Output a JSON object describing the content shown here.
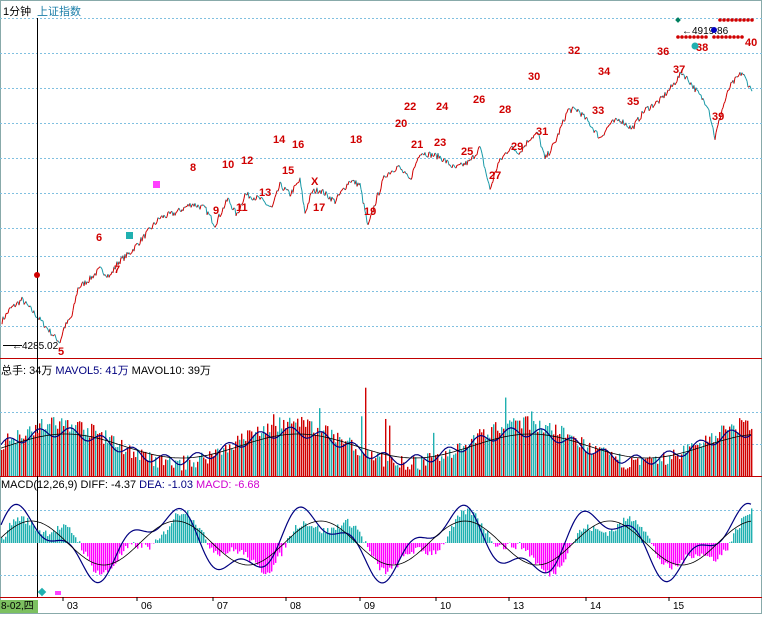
{
  "header": {
    "period": "1分钟",
    "index_name": "上证指数"
  },
  "price_panel": {
    "price_labels": {
      "low": "4285.02",
      "high": "4919.86"
    },
    "wave_labels": [
      "5",
      "6",
      "7",
      "8",
      "9",
      "10",
      "11",
      "12",
      "13",
      "14",
      "15",
      "16",
      "X",
      "17",
      "18",
      "19",
      "20",
      "21",
      "22",
      "23",
      "24",
      "25",
      "26",
      "27",
      "28",
      "29",
      "30",
      "31",
      "32",
      "33",
      "34",
      "35",
      "36",
      "37",
      "38",
      "39",
      "40"
    ]
  },
  "volume_panel": {
    "title": "总手: 34万",
    "mavol5": "MAVOL5: 41万",
    "mavol10": "MAVOL10: 39万"
  },
  "macd_panel": {
    "title": "MACD(12,26,9)",
    "diff": "DIFF: -4.37",
    "dea": "DEA: -1.03",
    "macd": "MACD: -6.68"
  },
  "x_axis": {
    "current_date": "8-02,四",
    "ticks": [
      "03",
      "06",
      "07",
      "08",
      "09",
      "10",
      "13",
      "14",
      "15"
    ]
  },
  "colors": {
    "up": "#d00000",
    "down": "#20b0b0",
    "diff_line": "#000080",
    "macd_neg": "#ff00ff",
    "macd_pos": "#20b0b0",
    "grid": "#80c0e0"
  },
  "chart_data": {
    "type": "line",
    "title": "上证指数",
    "xlabel": "",
    "ylabel": "",
    "categories": [
      "03",
      "06",
      "07",
      "08",
      "09",
      "10",
      "13",
      "14",
      "15"
    ],
    "series": [
      {
        "values": [
          4330,
          4400,
          4480,
          4520,
          4560,
          4640,
          4760,
          4840,
          4900
        ]
      }
    ],
    "annotations": [
      "4285.02",
      "4919.86"
    ],
    "grid": true
  }
}
